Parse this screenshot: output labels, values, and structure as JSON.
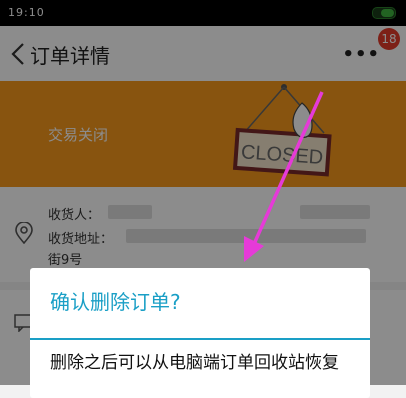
{
  "status_bar": {
    "time": "19:10"
  },
  "nav": {
    "title": "订单详情",
    "more": "•••",
    "badge": "18"
  },
  "banner": {
    "status": "交易关闭",
    "sign_text": "CLOSED"
  },
  "address": {
    "receiver_label": "收货人：",
    "address_label": "收货地址：",
    "address_line2": "街9号"
  },
  "dialog": {
    "title": "确认删除订单?",
    "message": "删除之后可以从电脑端订单回收站恢复"
  },
  "colors": {
    "banner": "#f79a1c",
    "dialog_accent": "#1a9fc6",
    "badge": "#e33b2b",
    "arrow": "#e63ad8"
  }
}
